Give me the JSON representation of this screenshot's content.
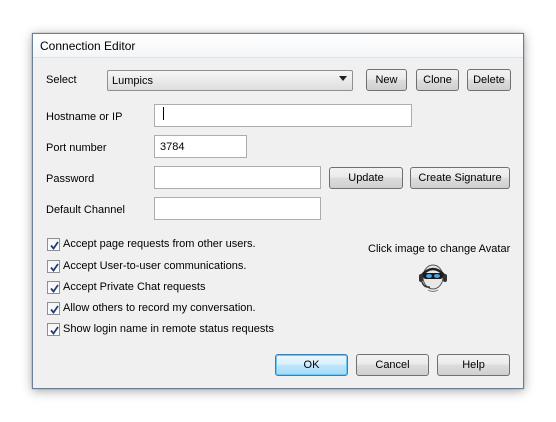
{
  "window": {
    "title": "Connection Editor"
  },
  "select": {
    "label": "Select",
    "value": "Lumpics",
    "buttons": {
      "new": "New",
      "clone": "Clone",
      "delete": "Delete"
    }
  },
  "form": {
    "hostname": {
      "label": "Hostname or IP",
      "value": ""
    },
    "port": {
      "label": "Port number",
      "value": "3784"
    },
    "password": {
      "label": "Password",
      "value": "",
      "update": "Update",
      "create_signature": "Create Signature"
    },
    "channel": {
      "label": "Default Channel",
      "value": ""
    }
  },
  "options": [
    {
      "label": "Accept page requests from other users.",
      "checked": true
    },
    {
      "label": "Accept User-to-user communications.",
      "checked": true
    },
    {
      "label": "Accept Private Chat requests",
      "checked": true
    },
    {
      "label": "Allow others to record my conversation.",
      "checked": true
    },
    {
      "label": "Show login name in remote status requests",
      "checked": true
    }
  ],
  "avatar": {
    "note": "Click image to change Avatar",
    "icon": "headset-avatar-icon"
  },
  "footer": {
    "ok": "OK",
    "cancel": "Cancel",
    "help": "Help"
  }
}
